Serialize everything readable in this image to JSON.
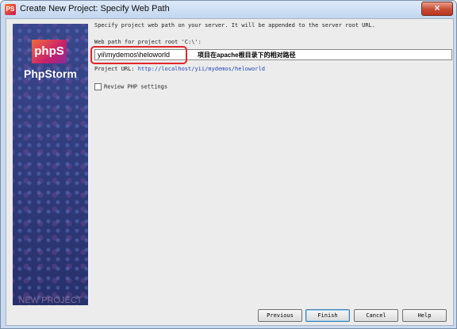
{
  "window": {
    "title": "Create New Project: Specify Web Path",
    "app_icon_text": "PS",
    "close_label": "×"
  },
  "sidebar": {
    "logo_badge": "phpS",
    "logo_text": "PhpStorm",
    "footer_text": "NEW PROJECT"
  },
  "main": {
    "description": "Specify project web path on your server. It will be appended to the server root URL.",
    "web_path_label": "Web path for project root 'C:\\':",
    "web_path_value": "yii\\mydemos\\heloworld",
    "annotation": "项目在apache根目录下的相对路径",
    "project_url_label": "Project URL:",
    "project_url_value": "http://localhost/yii/mydemos/heloworld",
    "review_php_label": "Review PHP settings",
    "review_php_checked": false
  },
  "buttons": {
    "previous": "Previous",
    "finish": "Finish",
    "cancel": "Cancel",
    "help": "Help"
  },
  "colors": {
    "accent_annotation": "#e0262a",
    "url_link": "#2246b6",
    "banner": "#2c3978"
  }
}
